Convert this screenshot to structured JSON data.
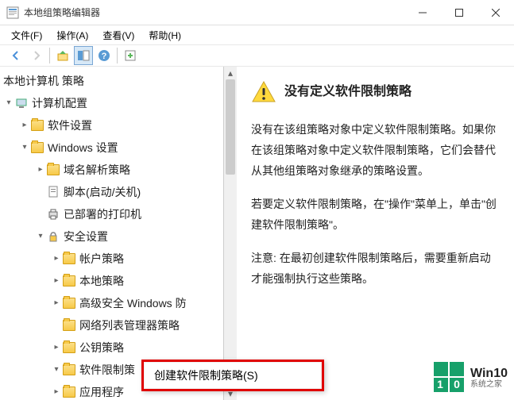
{
  "window": {
    "title": "本地组策略编辑器"
  },
  "menubar": {
    "file": "文件(F)",
    "action": "操作(A)",
    "view": "查看(V)",
    "help": "帮助(H)"
  },
  "tree": {
    "root": "本地计算机 策略",
    "computer_config": "计算机配置",
    "software_settings": "软件设置",
    "windows_settings": "Windows 设置",
    "dns_policy": "域名解析策略",
    "scripts": "脚本(启动/关机)",
    "deployed_printers": "已部署的打印机",
    "security_settings": "安全设置",
    "account_policy": "帐户策略",
    "local_policy": "本地策略",
    "advanced_windows": "高级安全 Windows 防",
    "network_list": "网络列表管理器策略",
    "pubkey_policy": "公钥策略",
    "software_restriction": "软件限制策",
    "app_programs": "应用程序"
  },
  "details": {
    "title": "没有定义软件限制策略",
    "p1": "没有在该组策略对象中定义软件限制策略。如果你在该组策略对象中定义软件限制策略，它们会替代从其他组策略对象继承的策略设置。",
    "p2": "若要定义软件限制策略，在\"操作\"菜单上，单击\"创建软件限制策略\"。",
    "p3": "注意: 在最初创建软件限制策略后，需要重新启动才能强制执行这些策略。"
  },
  "context_menu": {
    "create": "创建软件限制策略(S)"
  },
  "watermark": {
    "main": "Win10",
    "sub": "系统之家"
  }
}
